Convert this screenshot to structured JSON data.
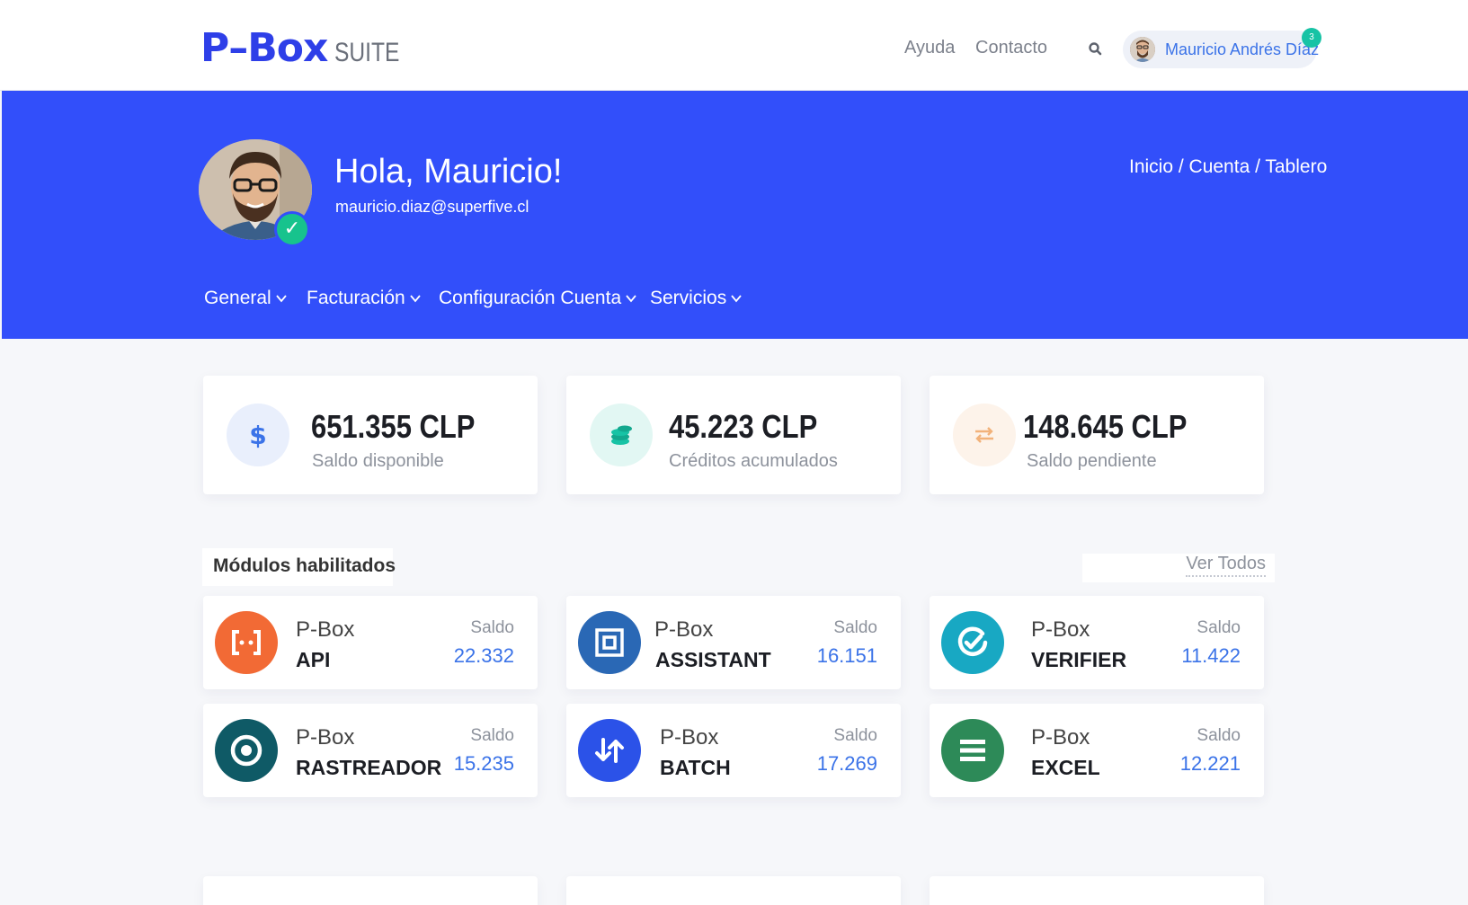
{
  "header": {
    "logo_main": "P–Box",
    "logo_sub": "SUITE",
    "nav": [
      "Ayuda",
      "Contacto"
    ],
    "user_name": "Mauricio Andrés Díaz",
    "notification_count": "3"
  },
  "hero": {
    "greeting": "Hola, Mauricio!",
    "email": "mauricio.diaz@superfive.cl",
    "breadcrumb": "Inicio / Cuenta / Tablero",
    "menu": [
      "General",
      "Facturación",
      "Configuración Cuenta",
      "Servicios"
    ]
  },
  "stats": [
    {
      "value": "651.355 CLP",
      "label": "Saldo disponible",
      "icon": "dollar-icon",
      "bg": "#e9effc",
      "fg": "#3b73e8"
    },
    {
      "value": "45.223 CLP",
      "label": "Créditos acumulados",
      "icon": "coins-icon",
      "bg": "#e2f7f3",
      "fg": "#17c3a5"
    },
    {
      "value": "148.645 CLP",
      "label": "Saldo pendiente",
      "icon": "exchange-icon",
      "bg": "#fdf3ea",
      "fg": "#f2b27a"
    }
  ],
  "modules": {
    "title": "Módulos habilitados",
    "view_all": "Ver Todos",
    "brand": "P-Box",
    "saldo_label": "Saldo",
    "items": [
      {
        "name": "API",
        "saldo": "22.332",
        "icon": "api-icon",
        "color": "#f26a35"
      },
      {
        "name": "ASSISTANT",
        "saldo": "16.151",
        "icon": "assistant-icon",
        "color": "#2a68b5"
      },
      {
        "name": "VERIFIER",
        "saldo": "11.422",
        "icon": "verifier-icon",
        "color": "#18a8c3"
      },
      {
        "name": "RASTREADOR",
        "saldo": "15.235",
        "icon": "target-icon",
        "color": "#0f5a66"
      },
      {
        "name": "BATCH",
        "saldo": "17.269",
        "icon": "transfer-arrows-icon",
        "color": "#2b52e8"
      },
      {
        "name": "EXCEL",
        "saldo": "12.221",
        "icon": "list-icon",
        "color": "#2d8a58"
      }
    ]
  }
}
